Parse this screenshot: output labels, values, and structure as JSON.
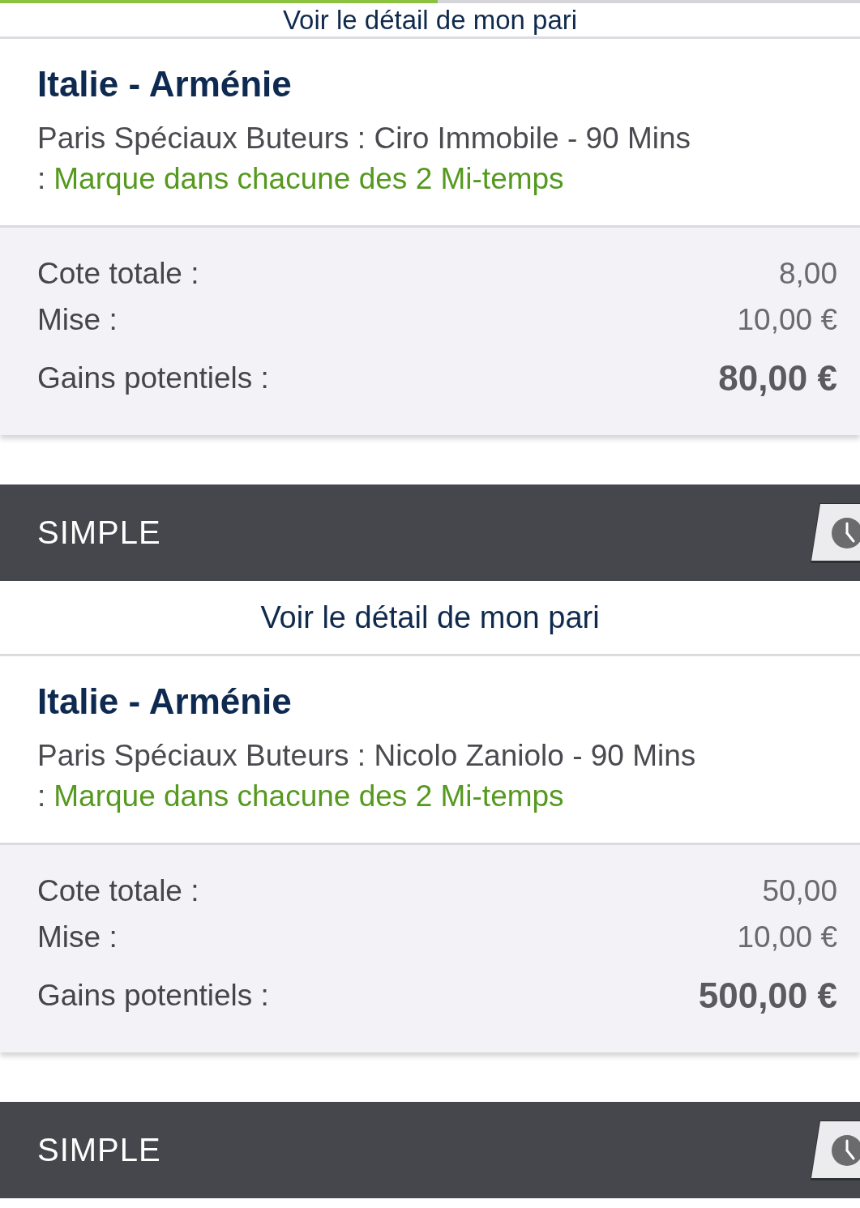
{
  "bets": [
    {
      "detail_link": "Voir le détail de mon pari",
      "match": "Italie - Arménie",
      "market": "Paris Spéciaux Buteurs : Ciro Immobile - 90 Mins",
      "separator": ":",
      "selection": "Marque dans chacune des 2 Mi-temps",
      "summary": [
        {
          "kind": "line",
          "label": "Cote totale :",
          "value": "8,00"
        },
        {
          "kind": "line",
          "label": "Mise :",
          "value": "10,00 €"
        },
        {
          "kind": "total",
          "label": "Gains potentiels :",
          "value": "80,00 €"
        }
      ]
    },
    {
      "type": "SIMPLE",
      "detail_link": "Voir le détail de mon pari",
      "match": "Italie - Arménie",
      "market": "Paris Spéciaux Buteurs : Nicolo Zaniolo - 90 Mins",
      "separator": ":",
      "selection": "Marque dans chacune des 2 Mi-temps",
      "summary": [
        {
          "kind": "line",
          "label": "Cote totale :",
          "value": "50,00"
        },
        {
          "kind": "line",
          "label": "Mise :",
          "value": "10,00 €"
        },
        {
          "kind": "total",
          "label": "Gains potentiels :",
          "value": "500,00 €"
        }
      ]
    },
    {
      "type": "SIMPLE"
    }
  ]
}
